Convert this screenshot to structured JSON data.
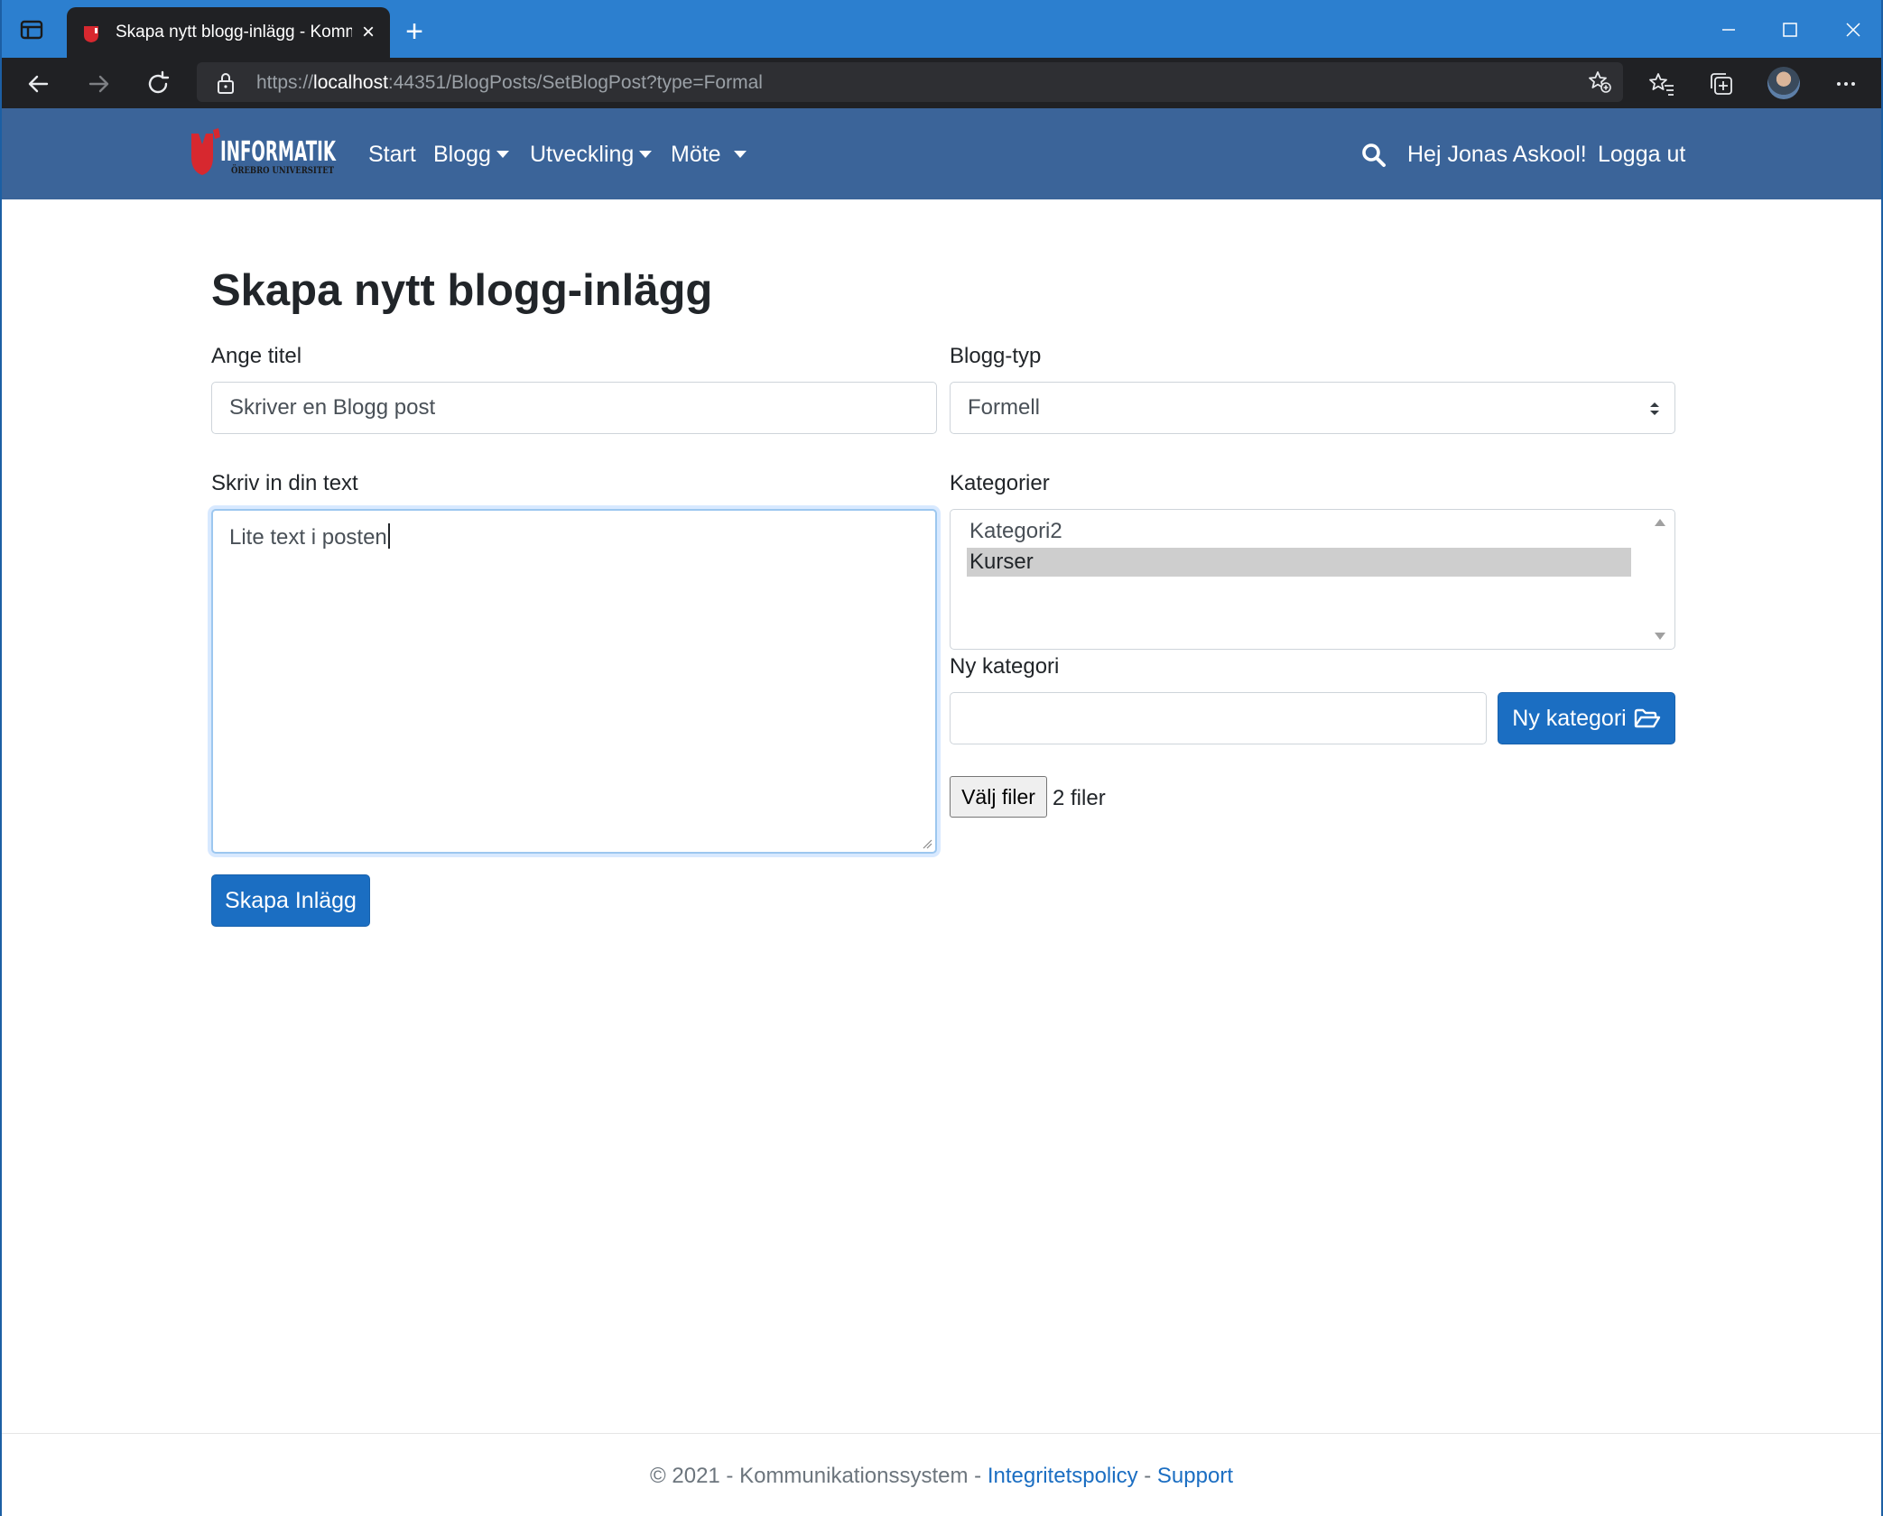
{
  "browser": {
    "tab_title": "Skapa nytt blogg-inlägg - Kommunikationssystem",
    "url_prefix": "https://",
    "url_host": "localhost",
    "url_rest": ":44351/BlogPosts/SetBlogPost?type=Formal",
    "new_tab": "+",
    "icons": [
      "tab-actions-icon",
      "site-favicon",
      "close-icon",
      "new-tab-icon",
      "minimize-icon",
      "maximize-icon",
      "window-close-icon",
      "back-icon",
      "forward-icon",
      "refresh-icon",
      "lock-icon",
      "add-favorite-icon",
      "favorites-icon",
      "collections-icon",
      "profile-avatar",
      "more-icon"
    ]
  },
  "nav": {
    "logo_text": "INFORMATIK",
    "logo_subtext": "ÖREBRO UNIVERSITET",
    "links": [
      {
        "label": "Start",
        "dropdown": false
      },
      {
        "label": "Blogg",
        "dropdown": true
      },
      {
        "label": "Utveckling",
        "dropdown": true
      },
      {
        "label": "Möte",
        "dropdown": true
      }
    ],
    "greeting": "Hej Jonas Askool!",
    "logout": "Logga ut"
  },
  "form": {
    "heading": "Skapa nytt blogg-inlägg",
    "title_label": "Ange titel",
    "title_value": "Skriver en Blogg post",
    "type_label": "Blogg-typ",
    "type_value": "Formell",
    "text_label": "Skriv in din text",
    "text_value": "Lite text i posten",
    "categories_label": "Kategorier",
    "categories": [
      {
        "label": "Kategori2",
        "selected": false
      },
      {
        "label": "Kurser",
        "selected": true
      }
    ],
    "new_category_label": "Ny kategori",
    "new_category_value": "",
    "new_category_button": "Ny kategori",
    "file_button": "Välj filer",
    "file_status": "2 filer",
    "submit_button": "Skapa Inlägg"
  },
  "footer": {
    "copyright": "© 2021 - Kommunikationssystem - ",
    "privacy_link": "Integritetspolicy",
    "separator": " - ",
    "support_link": "Support"
  },
  "colors": {
    "titlebar": "#2c7fcf",
    "navbar": "#3b6499",
    "primary": "#1b6ec2",
    "selected_option": "#cecece"
  }
}
